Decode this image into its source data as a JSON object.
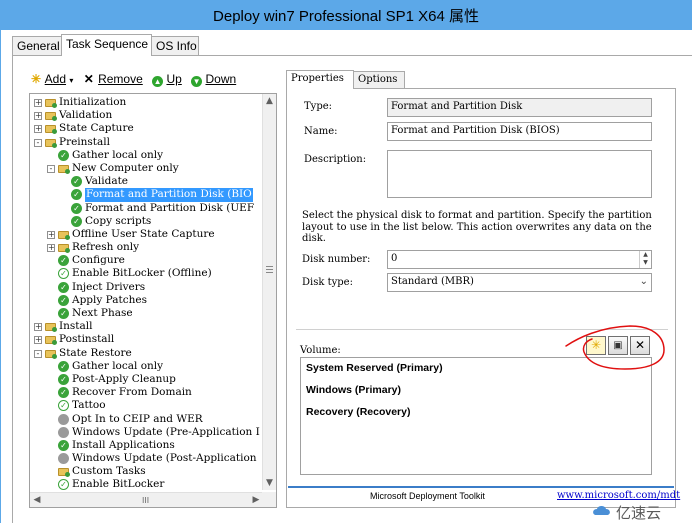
{
  "window": {
    "title": "Deploy win7 Professional SP1 X64 属性",
    "accent": "#5ca8e8"
  },
  "tabs": [
    "General",
    "Task Sequence",
    "OS Info"
  ],
  "active_tab": "Task Sequence",
  "toolbar": {
    "add": "Add",
    "remove": "Remove",
    "up": "Up",
    "down": "Down"
  },
  "tree": {
    "items": [
      {
        "label": "Initialization",
        "level": 0,
        "icon": "folder-icon",
        "expander": "+"
      },
      {
        "label": "Validation",
        "level": 0,
        "icon": "folder-icon",
        "expander": "+"
      },
      {
        "label": "State Capture",
        "level": 0,
        "icon": "folder-icon",
        "expander": "+"
      },
      {
        "label": "Preinstall",
        "level": 0,
        "icon": "folder-icon",
        "expander": "-"
      },
      {
        "label": "Gather local only",
        "level": 1,
        "icon": "check-icon",
        "expander": ""
      },
      {
        "label": "New Computer only",
        "level": 1,
        "icon": "folder-icon",
        "expander": "-"
      },
      {
        "label": "Validate",
        "level": 2,
        "icon": "check-icon",
        "expander": ""
      },
      {
        "label": "Format and Partition Disk (BIO",
        "level": 2,
        "icon": "check-icon",
        "expander": "",
        "selected": true
      },
      {
        "label": "Format and Partition Disk (UEF",
        "level": 2,
        "icon": "check-icon",
        "expander": ""
      },
      {
        "label": "Copy scripts",
        "level": 2,
        "icon": "check-icon",
        "expander": ""
      },
      {
        "label": "Offline User State Capture",
        "level": 1,
        "icon": "folder-icon",
        "expander": "+"
      },
      {
        "label": "Refresh only",
        "level": 1,
        "icon": "folder-icon",
        "expander": "+"
      },
      {
        "label": "Configure",
        "level": 1,
        "icon": "check-icon",
        "expander": ""
      },
      {
        "label": "Enable BitLocker (Offline)",
        "level": 1,
        "icon": "check-outline-icon",
        "expander": ""
      },
      {
        "label": "Inject Drivers",
        "level": 1,
        "icon": "check-icon",
        "expander": ""
      },
      {
        "label": "Apply Patches",
        "level": 1,
        "icon": "check-icon",
        "expander": ""
      },
      {
        "label": "Next Phase",
        "level": 1,
        "icon": "check-icon",
        "expander": ""
      },
      {
        "label": "Install",
        "level": 0,
        "icon": "folder-icon",
        "expander": "+"
      },
      {
        "label": "Postinstall",
        "level": 0,
        "icon": "folder-icon",
        "expander": "+"
      },
      {
        "label": "State Restore",
        "level": 0,
        "icon": "folder-icon",
        "expander": "-"
      },
      {
        "label": "Gather local only",
        "level": 1,
        "icon": "check-icon",
        "expander": ""
      },
      {
        "label": "Post-Apply Cleanup",
        "level": 1,
        "icon": "check-icon",
        "expander": ""
      },
      {
        "label": "Recover From Domain",
        "level": 1,
        "icon": "check-icon",
        "expander": ""
      },
      {
        "label": "Tattoo",
        "level": 1,
        "icon": "check-outline-icon",
        "expander": ""
      },
      {
        "label": "Opt In to CEIP and WER",
        "level": 1,
        "icon": "disabled-icon",
        "expander": ""
      },
      {
        "label": "Windows Update (Pre-Application I",
        "level": 1,
        "icon": "disabled-icon",
        "expander": ""
      },
      {
        "label": "Install Applications",
        "level": 1,
        "icon": "check-icon",
        "expander": ""
      },
      {
        "label": "Windows Update (Post-Application",
        "level": 1,
        "icon": "disabled-icon",
        "expander": ""
      },
      {
        "label": "Custom Tasks",
        "level": 1,
        "icon": "folder-icon",
        "expander": ""
      },
      {
        "label": "Enable BitLocker",
        "level": 1,
        "icon": "check-outline-icon",
        "expander": ""
      }
    ],
    "hscroll_grip": "III"
  },
  "right_tabs": [
    "Properties",
    "Options"
  ],
  "properties": {
    "type_label": "Type:",
    "type_value": "Format and Partition Disk",
    "name_label": "Name:",
    "name_value": "Format and Partition Disk (BIOS)",
    "description_label": "Description:",
    "description_value": "",
    "instruction": "Select the physical disk to format and partition.  Specify the partition layout to use in the list below. This action overwrites any data on the disk.",
    "disk_number_label": "Disk number:",
    "disk_number_value": "0",
    "disk_type_label": "Disk type:",
    "disk_type_value": "Standard (MBR)",
    "volume_label": "Volume:",
    "volumes": [
      "System Reserved (Primary)",
      "Windows (Primary)",
      "Recovery (Recovery)"
    ]
  },
  "footer": {
    "text": "Microsoft Deployment Toolkit",
    "link": "www.microsoft.com/mdt"
  },
  "watermark": {
    "text": "亿速云"
  },
  "colors": {
    "selection": "#3399ff",
    "annotation": "#e01010",
    "link": "#0000cc"
  }
}
